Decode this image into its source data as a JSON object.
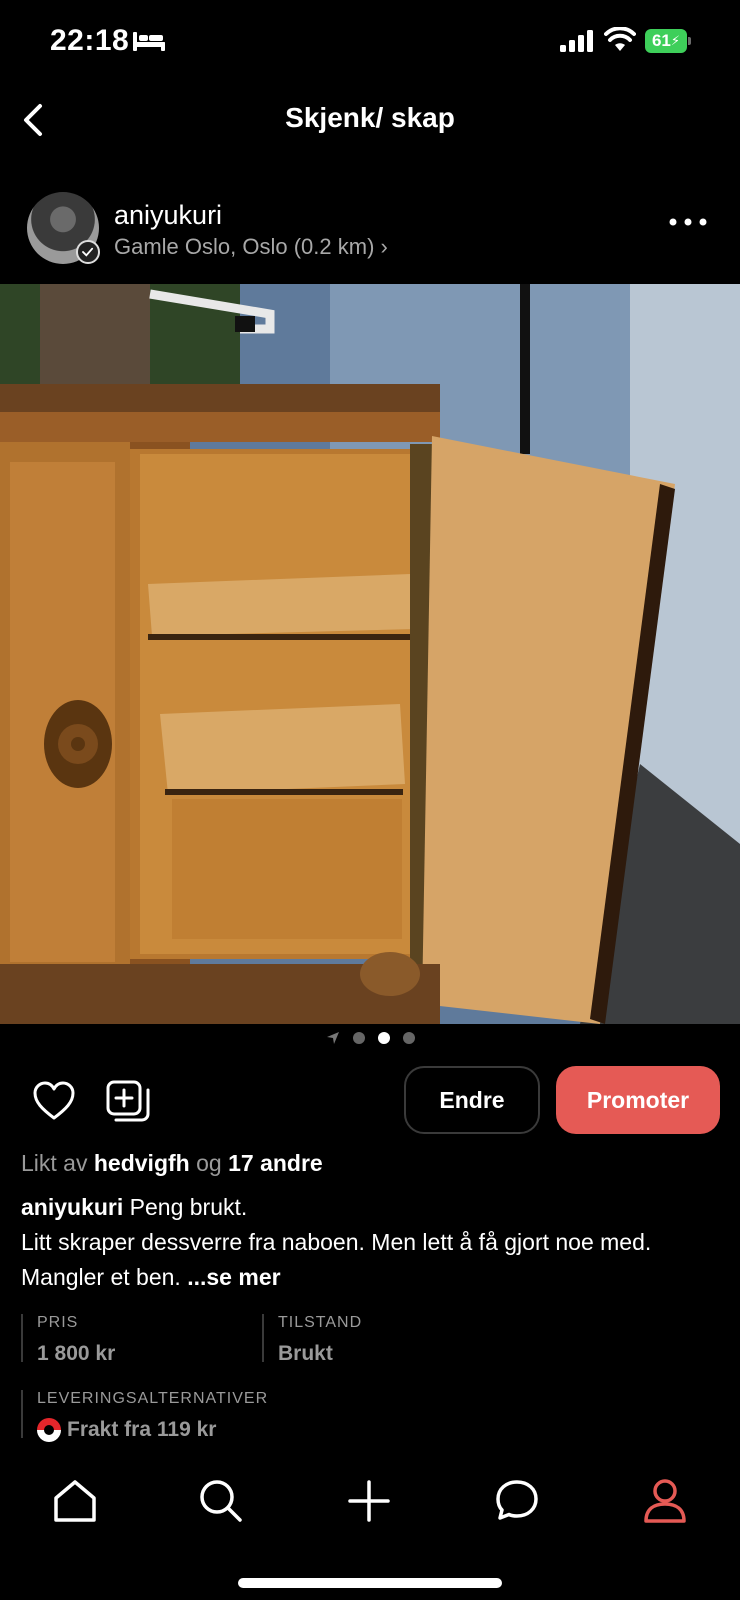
{
  "status_bar": {
    "time": "22:18",
    "battery": "61",
    "icons": [
      "bed-icon",
      "signal-icon",
      "wifi-icon",
      "battery-icon"
    ]
  },
  "header": {
    "title": "Skjenk/ skap",
    "back_icon": "back-chevron-icon"
  },
  "seller": {
    "username": "aniyukuri",
    "location": "Gamle Oslo, Oslo (0.2 km) ›",
    "more_icon": "more-horizontal-icon"
  },
  "carousel": {
    "image_count": 3,
    "active_index": 1
  },
  "actions": {
    "edit_label": "Endre",
    "promote_label": "Promoter",
    "promote_color": "#e55a55"
  },
  "likes": {
    "prefix": "Likt av",
    "user": "hedvigfh",
    "middle": "og",
    "others": "17 andre"
  },
  "description": {
    "author": "aniyukuri",
    "title": "Peng brukt.",
    "body": "Litt skraper dessverre fra naboen. Men lett å få gjort noe med. Mangler et ben.",
    "more": "...se mer"
  },
  "details": {
    "price_label": "PRIS",
    "price_value": "1 800 kr",
    "condition_label": "TILSTAND",
    "condition_value": "Brukt",
    "delivery_label": "LEVERINGSALTERNATIVER",
    "delivery_value": "Frakt fra 119 kr"
  },
  "tab_bar": {
    "tabs": [
      "home-icon",
      "search-icon",
      "add-icon",
      "chat-icon",
      "profile-icon"
    ],
    "active_tab": "profile-icon",
    "active_color": "#e55a55"
  }
}
